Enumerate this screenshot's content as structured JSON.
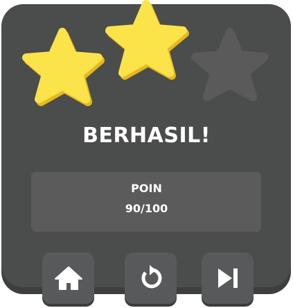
{
  "result": {
    "title": "BERHASIL!",
    "stars_earned": 2,
    "stars_total": 3
  },
  "score": {
    "label": "POIN",
    "value": "90/100"
  },
  "buttons": {
    "home_icon": "home-icon",
    "retry_icon": "restart-icon",
    "next_icon": "skip-next-icon"
  },
  "colors": {
    "panel": "#4b4c4c",
    "star_filled": "#fbe34a",
    "star_empty": "#5a5a5b",
    "text": "#ffffff"
  }
}
